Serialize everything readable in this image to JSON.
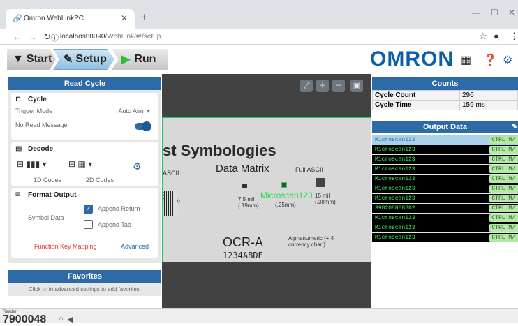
{
  "browser": {
    "tab_title": "Omron WebLinkPC",
    "tab_icon": "link-icon",
    "url_host": "localhost:8090",
    "url_path": "/WebLink/#!/setup"
  },
  "app": {
    "steps": [
      "Start",
      "Setup",
      "Run"
    ],
    "brand": "OMRON"
  },
  "read_cycle": {
    "title": "Read Cycle",
    "cycle": {
      "title": "Cycle",
      "trigger_label": "Trigger Mode",
      "trigger_value": "Auto Aim",
      "no_read_label": "No Read Message",
      "no_read_enabled": true
    },
    "decode": {
      "title": "Decode",
      "codes_1d": "1D Codes",
      "codes_2d": "2D Codes"
    },
    "format": {
      "title": "Format Output",
      "symbol_label": "Symbol Data",
      "append_return": "Append Return",
      "append_return_checked": true,
      "append_tab": "Append Tab",
      "append_tab_checked": false,
      "fkey": "Function Key Mapping",
      "advanced": "Advanced"
    }
  },
  "favorites": {
    "title": "Favorites",
    "hint": "Click ☆ in advanced settings to add favorites."
  },
  "image": {
    "headline": "st Symbologies",
    "dm_title": "Data Matrix",
    "dm_ascii": "Full ASCII",
    "ascii_left": "ASCII",
    "mil_left": "15 mil\n38mm)",
    "mil_a": "7.5 mil\n(.19mm)",
    "mil_b": "(.25mm)",
    "mil_c": "15 mil\n(.38mm)",
    "decoded": "Microscan123",
    "ocr_title": "OCR-A",
    "ocr_desc": "Alphanumeric (+ 4\ncurrency char.)",
    "ocr_sample": "1234ABDE"
  },
  "counts": {
    "title": "Counts",
    "rows": [
      {
        "label": "Cycle Count",
        "value": "296"
      },
      {
        "label": "Cycle Time",
        "value": "159 ms"
      }
    ]
  },
  "output": {
    "title": "Output Data",
    "ctrl": "CTRL M/",
    "rows": [
      "Microscan123",
      "Microscan123",
      "Microscan123",
      "Microscan123",
      "Microscan123",
      "Microscan123",
      "Microscan123",
      "398208808802",
      "Microscan123",
      "Microscan123",
      "Microscan123"
    ]
  },
  "footer": {
    "reader_label": "Reader",
    "reader_id": "7900048"
  }
}
